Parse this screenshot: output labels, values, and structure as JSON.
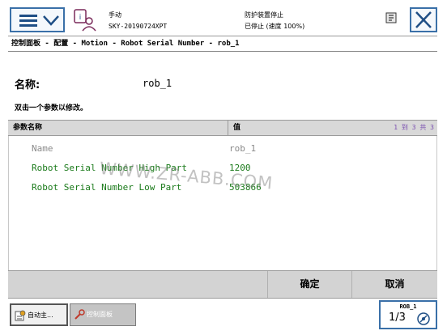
{
  "status": {
    "mode": "手动",
    "system_name": "SKY-20190724XPT",
    "protection": "防护装置停止",
    "run_state": "已停止 (速度 100%)"
  },
  "breadcrumb": "控制面板 - 配置 - Motion - Robot Serial Number - rob_1",
  "instance": {
    "name_label": "名称:",
    "name_value": "rob_1",
    "hint": "双击一个参数以修改。"
  },
  "table": {
    "headers": {
      "name": "参数名称",
      "value": "值"
    },
    "pagination": "1 到 3 共 3",
    "rows": [
      {
        "name": "Name",
        "value": "rob_1",
        "color": "#8a8a8a"
      },
      {
        "name": "Robot Serial Number High Part",
        "value": "1200",
        "color": "#1a7a1a"
      },
      {
        "name": "Robot Serial Number Low Part",
        "value": "503866",
        "color": "#1a7a1a"
      }
    ]
  },
  "watermark": "WWW.ZR-ABB.COM",
  "actions": {
    "ok": "确定",
    "cancel": "取消"
  },
  "taskbar": {
    "tasks": [
      {
        "label": "自动主...",
        "icon": "auto-production-icon"
      },
      {
        "label": "控制面板",
        "icon": "control-panel-icon"
      }
    ],
    "robot": {
      "label": "ROB_1",
      "fraction": "1/3"
    }
  },
  "colors": {
    "accent": "#3a70a8",
    "param_editable": "#1a7a1a",
    "param_readonly": "#8a8a8a",
    "pagination": "#7a4fb0"
  }
}
